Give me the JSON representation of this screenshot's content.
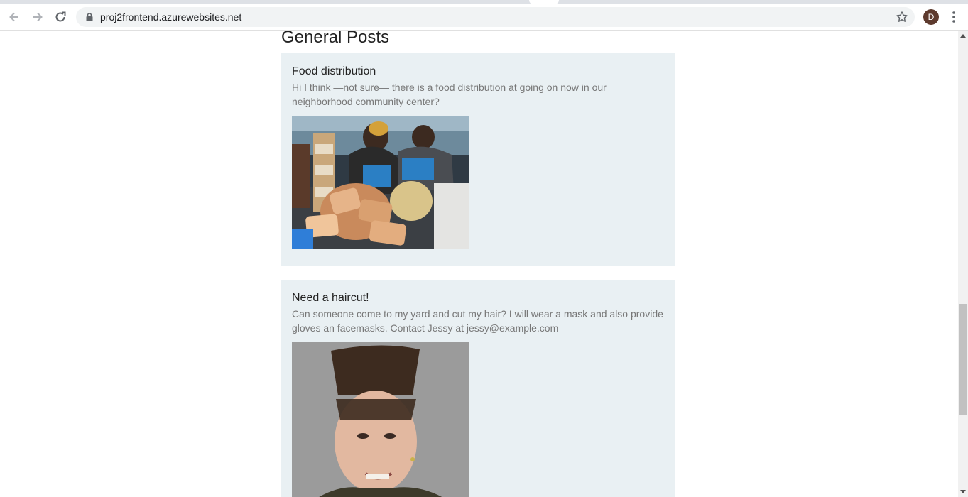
{
  "browser": {
    "url": "proj2frontend.azurewebsites.net",
    "avatar_initial": "D"
  },
  "page": {
    "section_title": "General Posts",
    "posts": [
      {
        "title": "Food distribution",
        "body": "Hi I think —not sure— there is a food distribution at going on now in our neighborhood community center?",
        "image_alt": "food distribution photo"
      },
      {
        "title": "Need a haircut!",
        "body": "Can someone come to my yard and cut my hair? I will wear a mask and also provide gloves an facemasks. Contact Jessy at jessy@example.com",
        "image_alt": "haircut photo"
      }
    ]
  },
  "colors": {
    "card_background": "#e9f0f3",
    "title_text": "#222222",
    "body_text": "#777777",
    "avatar": "#5d3a2e"
  }
}
